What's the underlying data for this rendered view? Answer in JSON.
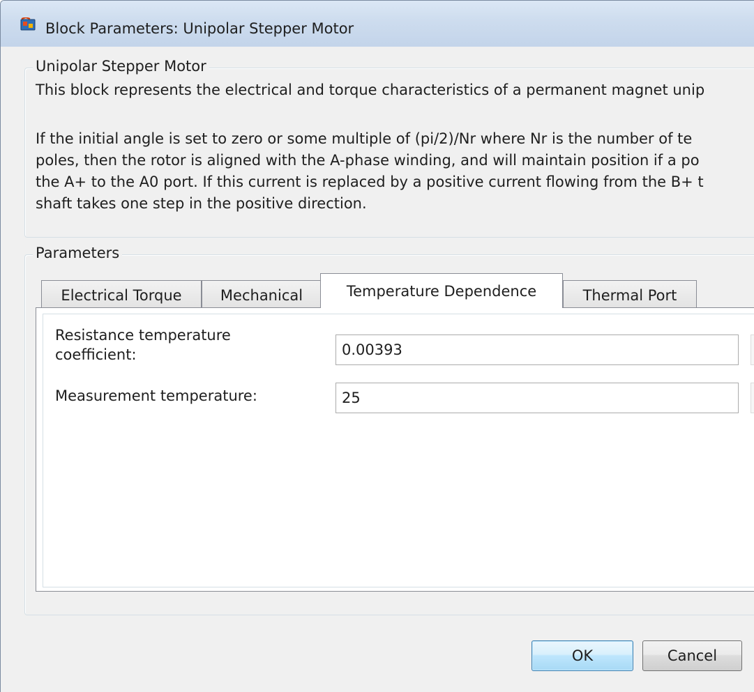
{
  "window": {
    "title": "Block Parameters: Unipolar Stepper Motor",
    "app_icon": "simulink-block-icon"
  },
  "description_group": {
    "legend": "Unipolar Stepper Motor",
    "paragraph1": "This block represents the electrical and torque characteristics of a permanent magnet unip",
    "paragraph2_lines": [
      "If the initial angle is set to zero or some multiple of (pi/2)/Nr where Nr is the number of te",
      "poles, then the rotor is aligned with the A-phase winding, and will maintain position if a po",
      "the A+ to the A0 port. If this current is replaced by a positive current flowing from the B+ t",
      "shaft takes one step in the positive direction."
    ]
  },
  "parameters_group": {
    "legend": "Parameters",
    "tabs": [
      {
        "label": "Electrical Torque",
        "active": false
      },
      {
        "label": "Mechanical",
        "active": false
      },
      {
        "label": "Temperature Dependence",
        "active": true
      },
      {
        "label": "Thermal Port",
        "active": false
      }
    ],
    "fields": {
      "resistance_temp_coeff": {
        "label_line1": "Resistance temperature",
        "label_line2": "coefficient:",
        "value": "0.00393"
      },
      "measurement_temperature": {
        "label": "Measurement temperature:",
        "value": "25"
      }
    }
  },
  "buttons": {
    "ok": "OK",
    "cancel": "Cancel"
  },
  "colors": {
    "titlebar": "#c9d9ec",
    "dialog_bg": "#f0f0f0",
    "default_button_border": "#3c7fb1"
  }
}
